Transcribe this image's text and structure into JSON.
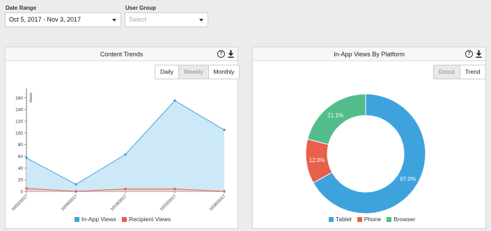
{
  "filters": {
    "date_range_label": "Date Range",
    "date_range_value": "Oct 5, 2017 - Nov 3, 2017",
    "user_group_label": "User Group",
    "user_group_placeholder": "Select"
  },
  "trends_panel": {
    "title": "Content Trends",
    "buttons": [
      "Daily",
      "Weekly",
      "Monthly"
    ],
    "active_button": "Weekly"
  },
  "platform_panel": {
    "title": "In-App Views By Platform",
    "buttons": [
      "Donut",
      "Trend"
    ],
    "active_button": "Donut"
  },
  "colors": {
    "in_app": "#3ea3dd",
    "in_app_fill": "#cde8f6",
    "recipient": "#e8604c",
    "tablet": "#3ea3dd",
    "phone": "#e8604c",
    "browser": "#52bd8b"
  },
  "chart_data": [
    {
      "type": "area",
      "title": "",
      "xlabel": "",
      "ylabel": "Views",
      "ylim": [
        0,
        170
      ],
      "yticks": [
        0,
        20,
        40,
        60,
        80,
        100,
        120,
        140,
        160
      ],
      "categories": [
        "10/02/2017",
        "10/09/2017",
        "10/16/2017",
        "10/23/2017",
        "10/30/2017"
      ],
      "series": [
        {
          "name": "In-App Views",
          "values": [
            57,
            12,
            63,
            155,
            105
          ]
        },
        {
          "name": "Recipient Views",
          "values": [
            5,
            0,
            4,
            4,
            0
          ]
        }
      ],
      "legend": "bottom"
    },
    {
      "type": "pie",
      "title": "",
      "categories": [
        "Tablet",
        "Phone",
        "Browser"
      ],
      "values": [
        67.0,
        12.0,
        21.1
      ],
      "labels": [
        "67.0%",
        "12.0%",
        "21.1%"
      ],
      "legend": "bottom"
    }
  ]
}
